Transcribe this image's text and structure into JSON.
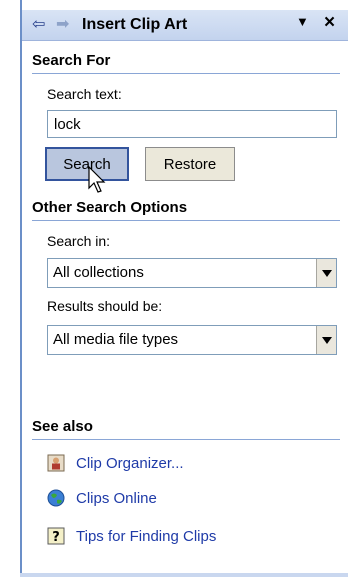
{
  "header": {
    "title": "Insert Clip Art",
    "back_icon": "back-arrow-icon",
    "forward_icon": "forward-arrow-icon",
    "menu_icon": "dropdown-arrow-icon",
    "close_icon": "close-icon",
    "back_glyph": "⇦",
    "forward_glyph": "➡",
    "menu_glyph": "▼",
    "close_glyph": "×"
  },
  "search_for": {
    "title": "Search For",
    "search_text_label": "Search text:",
    "search_text_value": "lock",
    "search_button": "Search",
    "restore_button": "Restore"
  },
  "other_options": {
    "title": "Other Search Options",
    "search_in_label": "Search in:",
    "search_in_value": "All collections",
    "results_label": "Results should be:",
    "results_value": "All media file types"
  },
  "see_also": {
    "title": "See also",
    "links": [
      {
        "label": "Clip Organizer...",
        "icon": "clip-organizer-icon"
      },
      {
        "label": "Clips Online",
        "icon": "globe-icon"
      },
      {
        "label": "Tips for Finding Clips",
        "icon": "help-icon"
      }
    ]
  },
  "colors": {
    "title_bar": "#c3d3ee",
    "accent_border": "#33549d",
    "link": "#1f3ba8"
  }
}
